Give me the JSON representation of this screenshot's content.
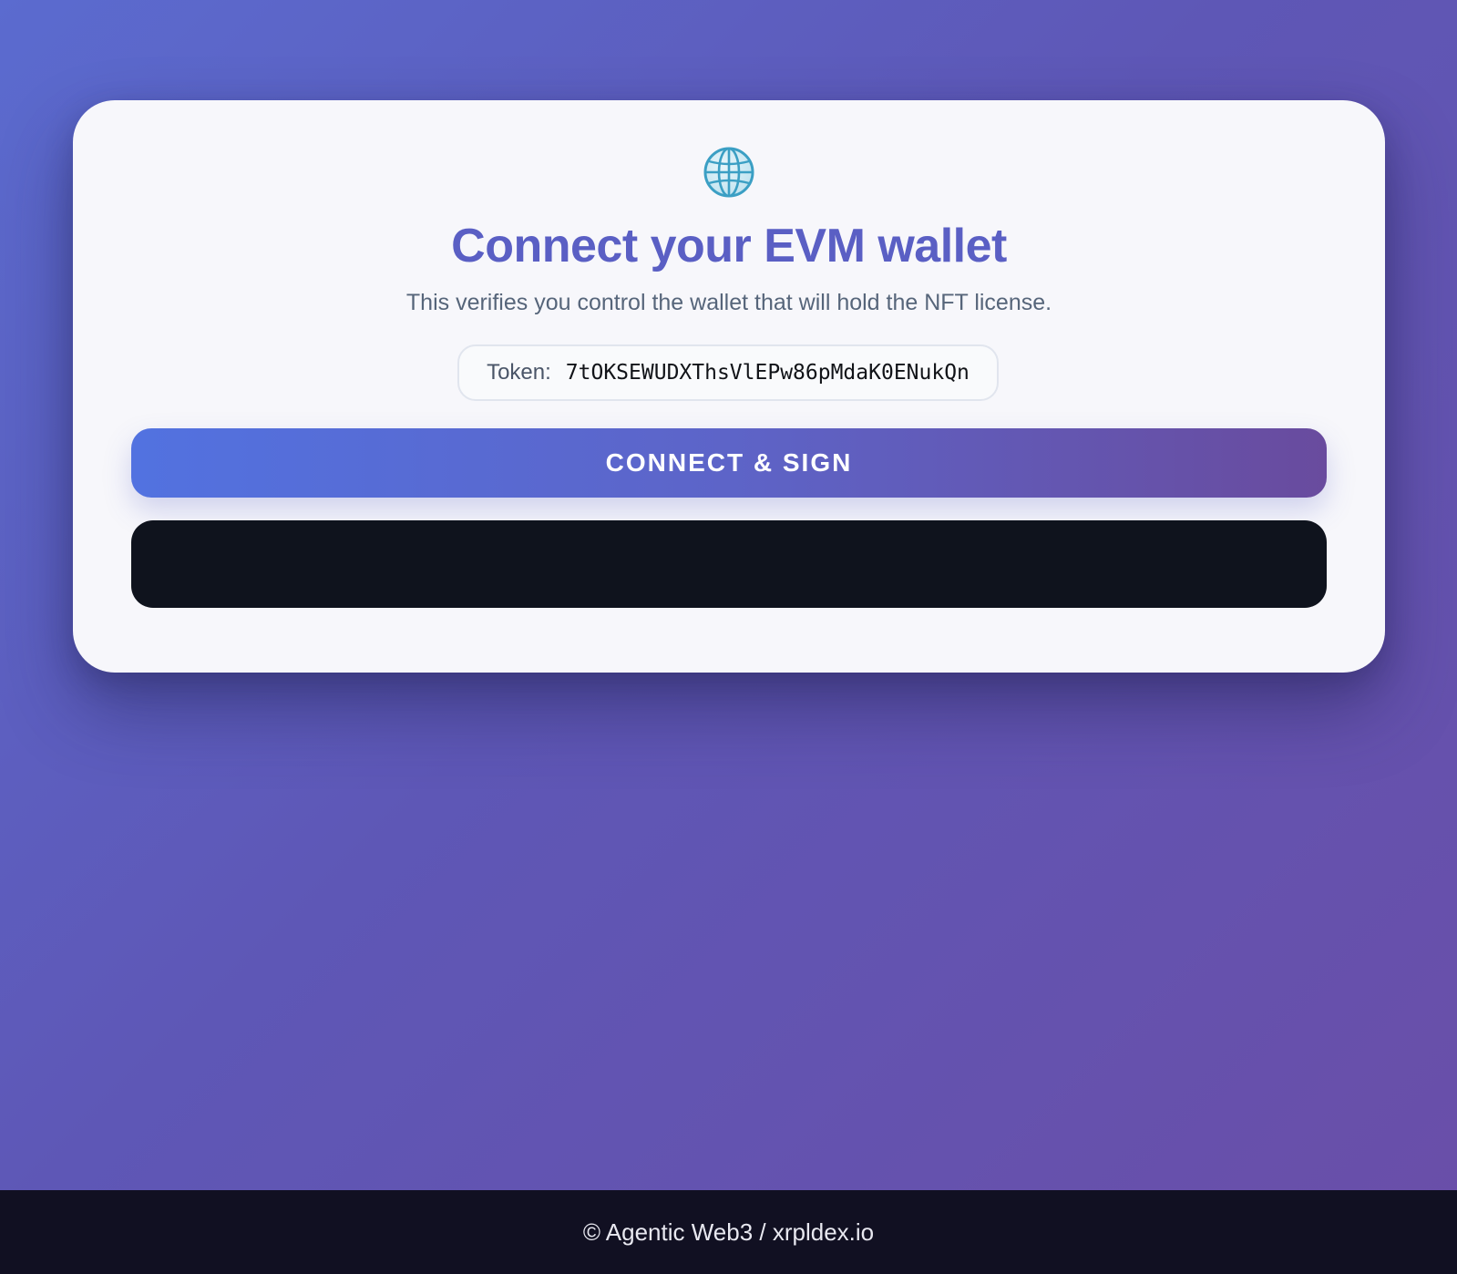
{
  "card": {
    "icon": "globe-icon",
    "title": "Connect your EVM wallet",
    "subtitle": "This verifies you control the wallet that will hold the NFT license.",
    "token": {
      "label": "Token:",
      "value": "7tOKSEWUDXThsVlEPw86pMdaK0ENukQn"
    },
    "connect_button_label": "CONNECT & SIGN"
  },
  "footer": {
    "text": "© Agentic Web3 / xrpldex.io"
  },
  "colors": {
    "accent": "#5a5fc4",
    "button_gradient_start": "#5272e0",
    "button_gradient_end": "#694b9e",
    "dark_panel": "#0f131d",
    "footer_bg": "#111022"
  }
}
